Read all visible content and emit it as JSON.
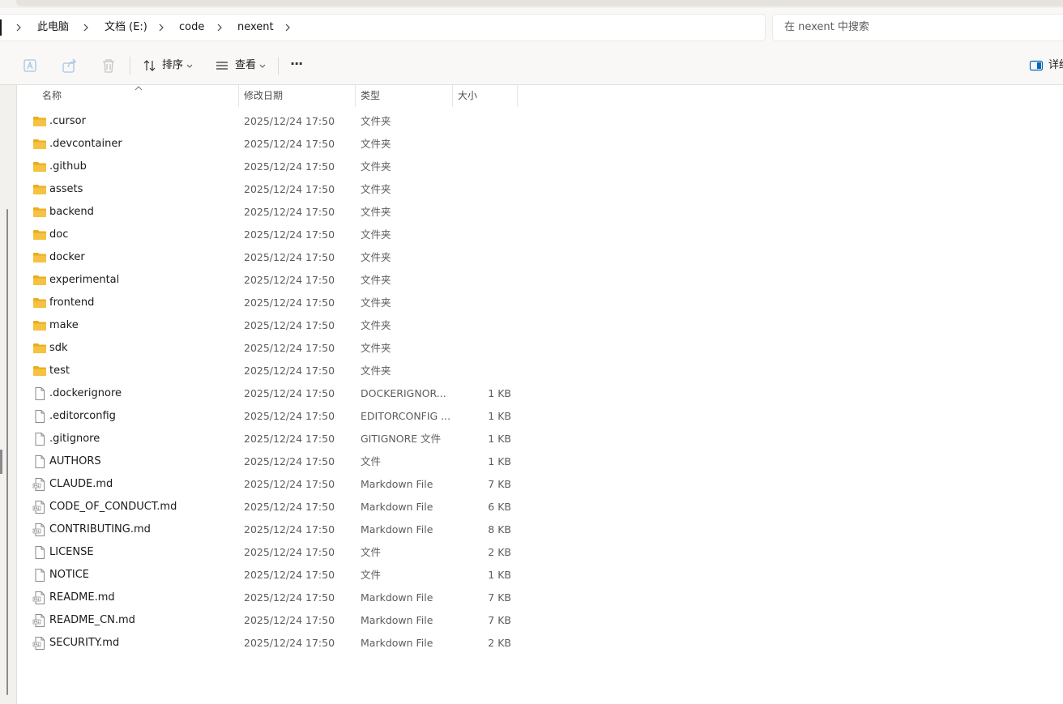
{
  "breadcrumb": [
    "此电脑",
    "文档 (E:)",
    "code",
    "nexent"
  ],
  "search": {
    "placeholder": "在 nexent 中搜索"
  },
  "toolbar": {
    "sort_label": "排序",
    "view_label": "查看",
    "more_label": "···",
    "details_label": "详细"
  },
  "columns": {
    "name": "名称",
    "modified": "修改日期",
    "type": "类型",
    "size": "大小"
  },
  "files": [
    {
      "name": ".cursor",
      "modified": "2025/12/24 17:50",
      "type": "文件夹",
      "size": "",
      "icon": "folder-icon"
    },
    {
      "name": ".devcontainer",
      "modified": "2025/12/24 17:50",
      "type": "文件夹",
      "size": "",
      "icon": "folder-icon"
    },
    {
      "name": ".github",
      "modified": "2025/12/24 17:50",
      "type": "文件夹",
      "size": "",
      "icon": "folder-icon"
    },
    {
      "name": "assets",
      "modified": "2025/12/24 17:50",
      "type": "文件夹",
      "size": "",
      "icon": "folder-icon"
    },
    {
      "name": "backend",
      "modified": "2025/12/24 17:50",
      "type": "文件夹",
      "size": "",
      "icon": "folder-icon"
    },
    {
      "name": "doc",
      "modified": "2025/12/24 17:50",
      "type": "文件夹",
      "size": "",
      "icon": "folder-icon"
    },
    {
      "name": "docker",
      "modified": "2025/12/24 17:50",
      "type": "文件夹",
      "size": "",
      "icon": "folder-icon"
    },
    {
      "name": "experimental",
      "modified": "2025/12/24 17:50",
      "type": "文件夹",
      "size": "",
      "icon": "folder-icon"
    },
    {
      "name": "frontend",
      "modified": "2025/12/24 17:50",
      "type": "文件夹",
      "size": "",
      "icon": "folder-icon"
    },
    {
      "name": "make",
      "modified": "2025/12/24 17:50",
      "type": "文件夹",
      "size": "",
      "icon": "folder-icon"
    },
    {
      "name": "sdk",
      "modified": "2025/12/24 17:50",
      "type": "文件夹",
      "size": "",
      "icon": "folder-icon"
    },
    {
      "name": "test",
      "modified": "2025/12/24 17:50",
      "type": "文件夹",
      "size": "",
      "icon": "folder-icon"
    },
    {
      "name": ".dockerignore",
      "modified": "2025/12/24 17:50",
      "type": "DOCKERIGNOR...",
      "size": "1 KB",
      "icon": "file-icon"
    },
    {
      "name": ".editorconfig",
      "modified": "2025/12/24 17:50",
      "type": "EDITORCONFIG ...",
      "size": "1 KB",
      "icon": "file-icon"
    },
    {
      "name": ".gitignore",
      "modified": "2025/12/24 17:50",
      "type": "GITIGNORE 文件",
      "size": "1 KB",
      "icon": "file-icon"
    },
    {
      "name": "AUTHORS",
      "modified": "2025/12/24 17:50",
      "type": "文件",
      "size": "1 KB",
      "icon": "file-icon"
    },
    {
      "name": "CLAUDE.md",
      "modified": "2025/12/24 17:50",
      "type": "Markdown File",
      "size": "7 KB",
      "icon": "markdown-file-icon"
    },
    {
      "name": "CODE_OF_CONDUCT.md",
      "modified": "2025/12/24 17:50",
      "type": "Markdown File",
      "size": "6 KB",
      "icon": "markdown-file-icon"
    },
    {
      "name": "CONTRIBUTING.md",
      "modified": "2025/12/24 17:50",
      "type": "Markdown File",
      "size": "8 KB",
      "icon": "markdown-file-icon"
    },
    {
      "name": "LICENSE",
      "modified": "2025/12/24 17:50",
      "type": "文件",
      "size": "2 KB",
      "icon": "file-icon"
    },
    {
      "name": "NOTICE",
      "modified": "2025/12/24 17:50",
      "type": "文件",
      "size": "1 KB",
      "icon": "file-icon"
    },
    {
      "name": "README.md",
      "modified": "2025/12/24 17:50",
      "type": "Markdown File",
      "size": "7 KB",
      "icon": "markdown-file-icon"
    },
    {
      "name": "README_CN.md",
      "modified": "2025/12/24 17:50",
      "type": "Markdown File",
      "size": "7 KB",
      "icon": "markdown-file-icon"
    },
    {
      "name": "SECURITY.md",
      "modified": "2025/12/24 17:50",
      "type": "Markdown File",
      "size": "2 KB",
      "icon": "markdown-file-icon"
    }
  ],
  "colors": {
    "folder": "#f5c242",
    "folder_tab": "#e9ad1d",
    "accent": "#0067c0"
  }
}
